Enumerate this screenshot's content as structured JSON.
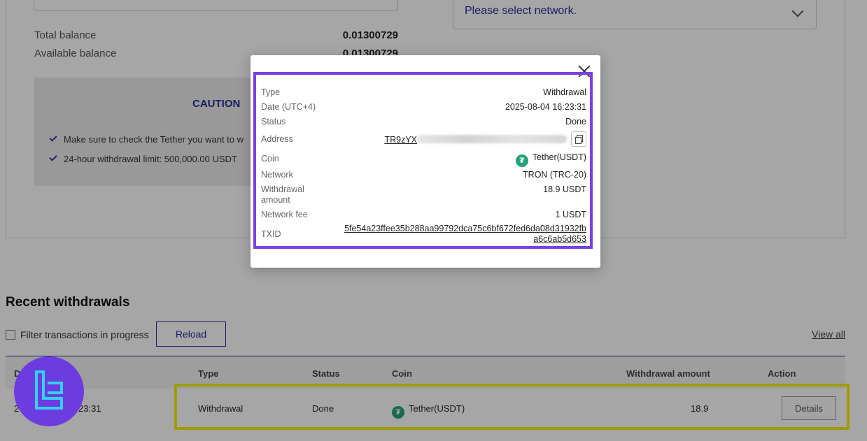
{
  "form": {
    "network_placeholder": "Please select network.",
    "total_balance_label": "Total balance",
    "total_balance_value": "0.01300729",
    "available_balance_label": "Available balance",
    "available_balance_value": "0.01300729"
  },
  "caution": {
    "title": "CAUTION",
    "items": [
      "Make sure to check the Tether you want to w",
      "24-hour withdrawal limit: 500,000.00 USDT"
    ]
  },
  "recent": {
    "title": "Recent withdrawals",
    "filter_label": "Filter transactions in progress",
    "reload_label": "Reload",
    "view_all_label": "View all",
    "headers": {
      "date": "D",
      "type": "Type",
      "status": "Status",
      "coin": "Coin",
      "amount": "Withdrawal amount",
      "action": "Action"
    },
    "row": {
      "date": "2",
      "time": "23:31",
      "type": "Withdrawal",
      "status": "Done",
      "coin": "Tether(USDT)",
      "amount": "18.9",
      "action_label": "Details"
    }
  },
  "modal": {
    "type_label": "Type",
    "type_value": "Withdrawal",
    "date_label": "Date (UTC+4)",
    "date_value": "2025-08-04 16:23:31",
    "status_label": "Status",
    "status_value": "Done",
    "address_label": "Address",
    "address_value": "TR9zYX",
    "coin_label": "Coin",
    "coin_value": "Tether(USDT)",
    "network_label": "Network",
    "network_value": "TRON (TRC-20)",
    "amount_label_1": "Withdrawal",
    "amount_label_2": "amount",
    "amount_value": "18.9 USDT",
    "fee_label": "Network fee",
    "fee_value": "1 USDT",
    "txid_label": "TXID",
    "txid_line1": "5fe54a23ffee35b288aa99792dca75c6bf672fed6da08d31932fb",
    "txid_line2": "a6c6ab5d653"
  },
  "colors": {
    "accent": "#2d2d9e",
    "tether": "#26a17b",
    "highlight_yellow": "#f2f200",
    "highlight_purple": "#7b3fe4",
    "logo": "#6c3ce0"
  }
}
